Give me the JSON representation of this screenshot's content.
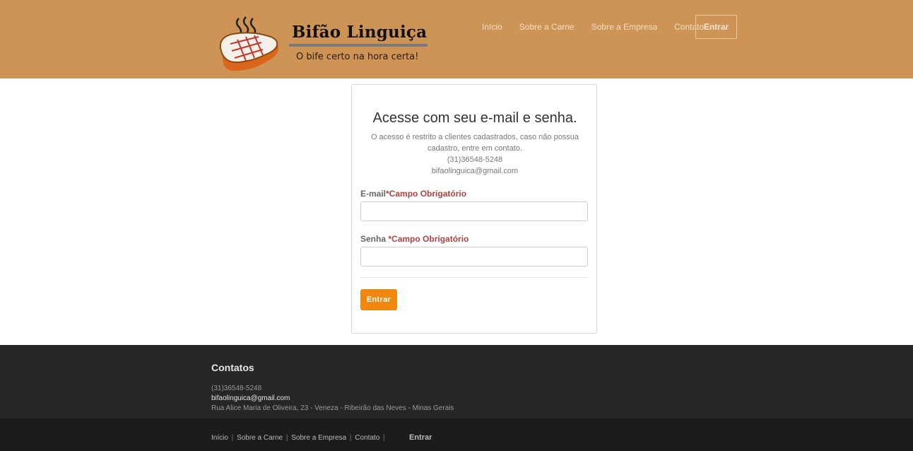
{
  "brand": {
    "name": "Bifão Linguiça",
    "tagline": "O bife certo na hora certa!"
  },
  "nav": {
    "items": [
      {
        "label": "Início"
      },
      {
        "label": "Sobre a Carne"
      },
      {
        "label": "Sobre a Empresa"
      },
      {
        "label": "Contato"
      }
    ],
    "button_label": "Entrar"
  },
  "login": {
    "title": "Acesse com seu e-mail e senha.",
    "description_line1": "O acesso é restrito a clientes cadastrados, caso não possua",
    "description_line2": "cadastro, entre em contato.",
    "phone": "(31)36548-5248",
    "email": "bifaolinguica@gmail.com",
    "email_label": "E-mail",
    "email_required": "*Campo Obrigatório",
    "email_value": "",
    "password_label": "Senha ",
    "password_required": "*Campo Obrigatório",
    "password_value": "",
    "submit_label": "Entrar"
  },
  "footer": {
    "title": "Contatos",
    "phone": "(31)36548-5248",
    "email": "bifaolinguica@gmail.com",
    "address": "Rua Alice Maria de Oliveira, 23 - Veneza - Ribeirão das Neves - Minas Gerais",
    "links": [
      "Início",
      "Sobre a Carne",
      "Sobre a Empresa",
      "Contato"
    ],
    "entrar_label": "Entrar"
  },
  "colors": {
    "header_bg": "#cd9456",
    "button_orange": "#f0870f",
    "required_red": "#a94442",
    "footer_bg": "#262626"
  }
}
